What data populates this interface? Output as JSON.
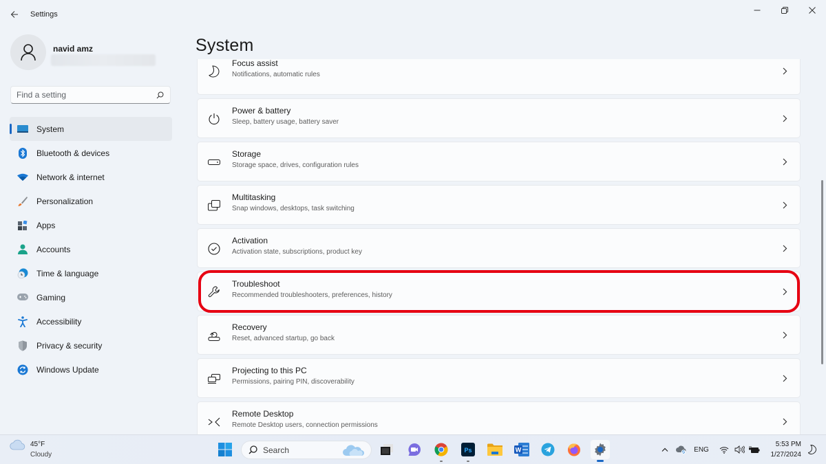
{
  "window": {
    "app_title": "Settings",
    "controls": {
      "minimize": "minimize",
      "maximize": "restore",
      "close": "close"
    }
  },
  "profile": {
    "name": "navid amz",
    "email": ""
  },
  "search": {
    "placeholder": "Find a setting",
    "value": ""
  },
  "nav": {
    "items": [
      {
        "label": "System",
        "icon": "system-icon",
        "active": true
      },
      {
        "label": "Bluetooth & devices",
        "icon": "bluetooth-icon"
      },
      {
        "label": "Network & internet",
        "icon": "wifi-icon"
      },
      {
        "label": "Personalization",
        "icon": "brush-icon"
      },
      {
        "label": "Apps",
        "icon": "apps-icon"
      },
      {
        "label": "Accounts",
        "icon": "accounts-icon"
      },
      {
        "label": "Time & language",
        "icon": "time-language-icon"
      },
      {
        "label": "Gaming",
        "icon": "gamepad-icon"
      },
      {
        "label": "Accessibility",
        "icon": "accessibility-icon"
      },
      {
        "label": "Privacy & security",
        "icon": "shield-icon"
      },
      {
        "label": "Windows Update",
        "icon": "update-icon"
      }
    ]
  },
  "main": {
    "title": "System",
    "cards": [
      {
        "title": "Focus assist",
        "subtitle": "Notifications, automatic rules",
        "icon": "moon-icon"
      },
      {
        "title": "Power & battery",
        "subtitle": "Sleep, battery usage, battery saver",
        "icon": "power-icon"
      },
      {
        "title": "Storage",
        "subtitle": "Storage space, drives, configuration rules",
        "icon": "storage-icon"
      },
      {
        "title": "Multitasking",
        "subtitle": "Snap windows, desktops, task switching",
        "icon": "multitasking-icon"
      },
      {
        "title": "Activation",
        "subtitle": "Activation state, subscriptions, product key",
        "icon": "check-circle-icon"
      },
      {
        "title": "Troubleshoot",
        "subtitle": "Recommended troubleshooters, preferences, history",
        "icon": "wrench-icon",
        "highlighted": true
      },
      {
        "title": "Recovery",
        "subtitle": "Reset, advanced startup, go back",
        "icon": "recovery-icon"
      },
      {
        "title": "Projecting to this PC",
        "subtitle": "Permissions, pairing PIN, discoverability",
        "icon": "projecting-icon"
      },
      {
        "title": "Remote Desktop",
        "subtitle": "Remote Desktop users, connection permissions",
        "icon": "remote-desktop-icon"
      }
    ],
    "highlight_color": "#e60012"
  },
  "taskbar": {
    "weather": {
      "temp": "45°F",
      "condition": "Cloudy"
    },
    "search_label": "Search",
    "apps": [
      {
        "name": "start",
        "icon": "windows-start-icon"
      },
      {
        "name": "task view",
        "icon": "task-view-icon"
      },
      {
        "name": "teams chat",
        "icon": "chat-icon"
      },
      {
        "name": "chrome",
        "icon": "chrome-icon",
        "running": true
      },
      {
        "name": "photoshop",
        "icon": "photoshop-icon",
        "running": true,
        "label": "Ps"
      },
      {
        "name": "file explorer",
        "icon": "folder-icon"
      },
      {
        "name": "word",
        "icon": "word-icon",
        "label": "W"
      },
      {
        "name": "telegram",
        "icon": "telegram-icon"
      },
      {
        "name": "firefox",
        "icon": "firefox-icon"
      },
      {
        "name": "settings",
        "icon": "settings-gear-icon",
        "active": true
      }
    ],
    "tray": {
      "language": "ENG",
      "time": "5:53 PM",
      "date": "1/27/2024"
    }
  },
  "colors": {
    "accent": "#1a67c4",
    "window_bg": "#eff3f8",
    "card_bg": "#fbfcfd"
  }
}
